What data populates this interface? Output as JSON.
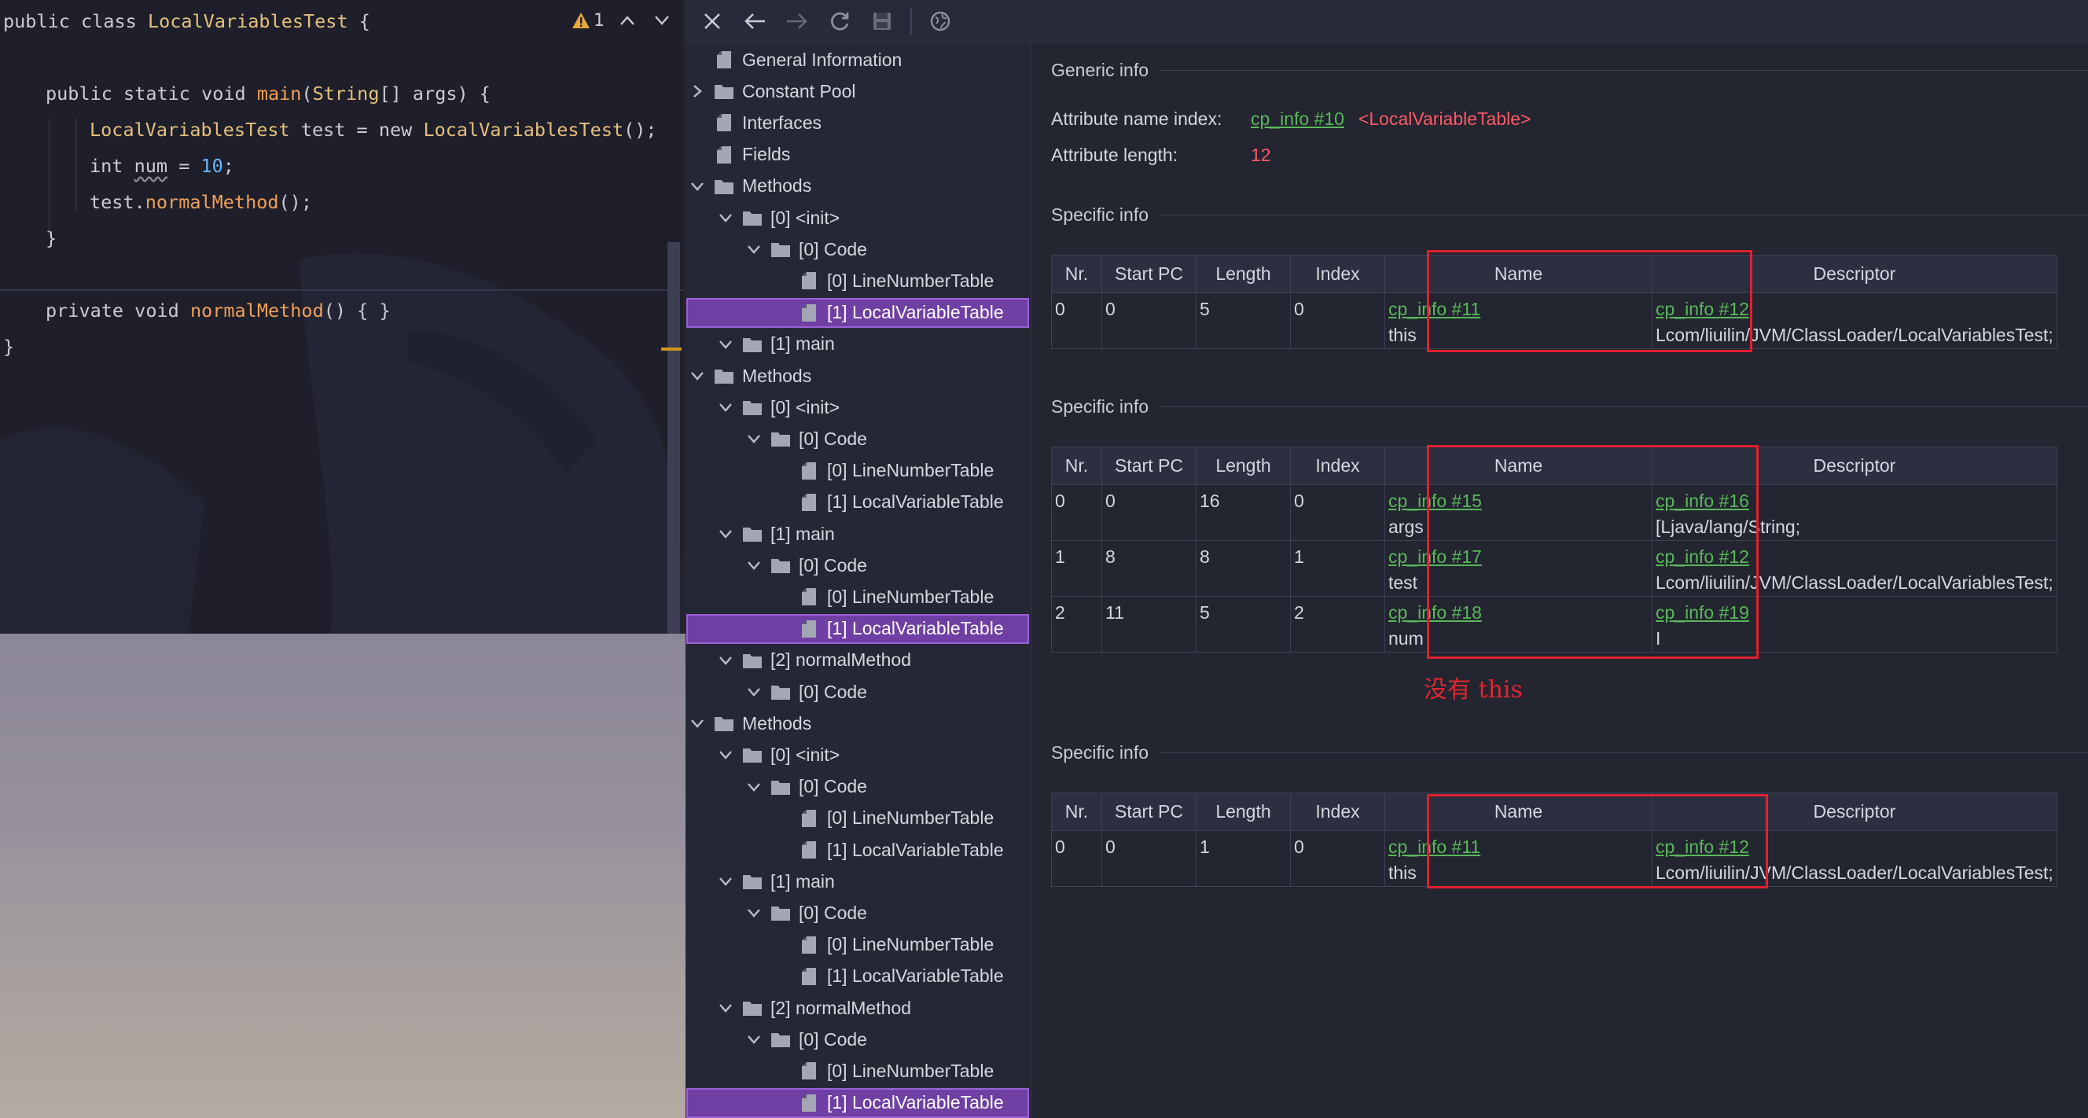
{
  "editor": {
    "warning_count": "1",
    "lines": [
      {
        "t1": "public class ",
        "cls": "LocalVariablesTest",
        "t2": " {"
      },
      {
        "text": ""
      },
      {
        "kw": "public static void ",
        "fn": "main",
        "p1": "(",
        "cls": "String",
        "p2": "[] args) {"
      },
      {
        "cls1": "LocalVariablesTest",
        "t1": " test = new ",
        "cls2": "LocalVariablesTest",
        "t2": "();"
      },
      {
        "kw": "int ",
        "var": "num",
        "t1": " = ",
        "num": "10",
        "t2": ";"
      },
      {
        "t1": "test.",
        "fn": "normalMethod",
        "t2": "();"
      },
      {
        "text": "}"
      },
      {
        "text": ""
      },
      {
        "kw": "private void ",
        "fn": "normalMethod",
        "t2": "() { }"
      },
      {
        "text": "}"
      }
    ]
  },
  "toolbar": {
    "icons": [
      "close-icon",
      "back-arrow-icon",
      "forward-arrow-icon",
      "refresh-icon",
      "save-icon",
      "web-icon"
    ]
  },
  "tree": {
    "nodes": [
      {
        "label": "General Information",
        "indent": 0,
        "chev": "",
        "icon": "file"
      },
      {
        "label": "Constant Pool",
        "indent": 0,
        "chev": "right",
        "icon": "folder"
      },
      {
        "label": "Interfaces",
        "indent": 0,
        "chev": "",
        "icon": "file"
      },
      {
        "label": "Fields",
        "indent": 0,
        "chev": "",
        "icon": "file"
      },
      {
        "label": "Methods",
        "indent": 0,
        "chev": "down",
        "icon": "folder"
      },
      {
        "label": "[0] <init>",
        "indent": 1,
        "chev": "down",
        "icon": "folder"
      },
      {
        "label": "[0] Code",
        "indent": 2,
        "chev": "down",
        "icon": "folder"
      },
      {
        "label": "[0] LineNumberTable",
        "indent": 3,
        "chev": "",
        "icon": "file"
      },
      {
        "label": "[1] LocalVariableTable",
        "indent": 3,
        "chev": "",
        "icon": "file",
        "selected": true
      },
      {
        "label": "[1] main",
        "indent": 1,
        "chev": "down",
        "icon": "folder"
      },
      {
        "label": "Methods",
        "indent": 0,
        "chev": "down",
        "icon": "folder"
      },
      {
        "label": "[0] <init>",
        "indent": 1,
        "chev": "down",
        "icon": "folder"
      },
      {
        "label": "[0] Code",
        "indent": 2,
        "chev": "down",
        "icon": "folder"
      },
      {
        "label": "[0] LineNumberTable",
        "indent": 3,
        "chev": "",
        "icon": "file"
      },
      {
        "label": "[1] LocalVariableTable",
        "indent": 3,
        "chev": "",
        "icon": "file"
      },
      {
        "label": "[1] main",
        "indent": 1,
        "chev": "down",
        "icon": "folder"
      },
      {
        "label": "[0] Code",
        "indent": 2,
        "chev": "down",
        "icon": "folder"
      },
      {
        "label": "[0] LineNumberTable",
        "indent": 3,
        "chev": "",
        "icon": "file"
      },
      {
        "label": "[1] LocalVariableTable",
        "indent": 3,
        "chev": "",
        "icon": "file",
        "selected": true
      },
      {
        "label": "[2] normalMethod",
        "indent": 1,
        "chev": "down",
        "icon": "folder"
      },
      {
        "label": "[0] Code",
        "indent": 2,
        "chev": "down",
        "icon": "folder"
      },
      {
        "label": "Methods",
        "indent": 0,
        "chev": "down",
        "icon": "folder"
      },
      {
        "label": "[0] <init>",
        "indent": 1,
        "chev": "down",
        "icon": "folder"
      },
      {
        "label": "[0] Code",
        "indent": 2,
        "chev": "down",
        "icon": "folder"
      },
      {
        "label": "[0] LineNumberTable",
        "indent": 3,
        "chev": "",
        "icon": "file"
      },
      {
        "label": "[1] LocalVariableTable",
        "indent": 3,
        "chev": "",
        "icon": "file"
      },
      {
        "label": "[1] main",
        "indent": 1,
        "chev": "down",
        "icon": "folder"
      },
      {
        "label": "[0] Code",
        "indent": 2,
        "chev": "down",
        "icon": "folder"
      },
      {
        "label": "[0] LineNumberTable",
        "indent": 3,
        "chev": "",
        "icon": "file"
      },
      {
        "label": "[1] LocalVariableTable",
        "indent": 3,
        "chev": "",
        "icon": "file"
      },
      {
        "label": "[2] normalMethod",
        "indent": 1,
        "chev": "down",
        "icon": "folder"
      },
      {
        "label": "[0] Code",
        "indent": 2,
        "chev": "down",
        "icon": "folder"
      },
      {
        "label": "[0] LineNumberTable",
        "indent": 3,
        "chev": "",
        "icon": "file"
      },
      {
        "label": "[1] LocalVariableTable",
        "indent": 3,
        "chev": "",
        "icon": "file",
        "selected": true
      }
    ]
  },
  "detail": {
    "generic_title": "Generic info",
    "attr_name_label": "Attribute name index:",
    "attr_name_link": "cp_info #10",
    "attr_name_value": "<LocalVariableTable>",
    "attr_len_label": "Attribute length:",
    "attr_len_value": "12",
    "specific_title": "Specific info",
    "columns": [
      "Nr.",
      "Start PC",
      "Length",
      "Index",
      "Name",
      "Descriptor"
    ],
    "tables": [
      {
        "rows": [
          {
            "nr": "0",
            "start": "0",
            "len": "5",
            "idx": "0",
            "name_link": "cp_info #11",
            "name": "this",
            "desc_link": "cp_info #12",
            "desc": "Lcom/liuilin/JVM/ClassLoader/LocalVariablesTest;"
          }
        ]
      },
      {
        "rows": [
          {
            "nr": "0",
            "start": "0",
            "len": "16",
            "idx": "0",
            "name_link": "cp_info #15",
            "name": "args",
            "desc_link": "cp_info #16",
            "desc": "[Ljava/lang/String;"
          },
          {
            "nr": "1",
            "start": "8",
            "len": "8",
            "idx": "1",
            "name_link": "cp_info #17",
            "name": "test",
            "desc_link": "cp_info #12",
            "desc": "Lcom/liuilin/JVM/ClassLoader/LocalVariablesTest;"
          },
          {
            "nr": "2",
            "start": "11",
            "len": "5",
            "idx": "2",
            "name_link": "cp_info #18",
            "name": "num",
            "desc_link": "cp_info #19",
            "desc": "I"
          }
        ]
      },
      {
        "rows": [
          {
            "nr": "0",
            "start": "0",
            "len": "1",
            "idx": "0",
            "name_link": "cp_info #11",
            "name": "this",
            "desc_link": "cp_info #12",
            "desc": "Lcom/liuilin/JVM/ClassLoader/LocalVariablesTest;"
          }
        ]
      }
    ],
    "annotation": "没有 this"
  },
  "colors": {
    "accent_selected": "#6f3fa4",
    "link_green": "#59b85a",
    "error_red": "#e0202e",
    "keyword_yellow": "#e5c07b",
    "function_orange": "#f0a059",
    "number_blue": "#6cb6ff"
  }
}
